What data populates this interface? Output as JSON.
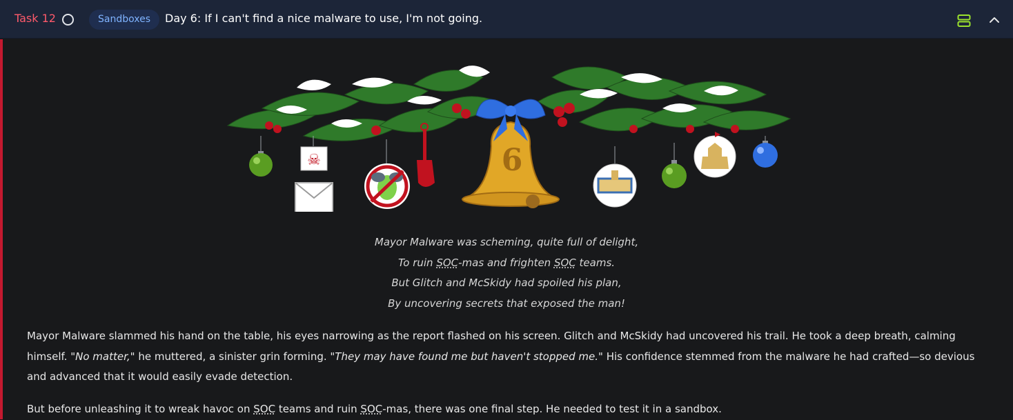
{
  "header": {
    "task_label": "Task 12",
    "tag": "Sandboxes",
    "title": "Day 6: If I can't find a nice malware to use, I'm not going."
  },
  "poem": {
    "line1": "Mayor Malware was scheming, quite full of delight,",
    "line2_pre": "To ruin ",
    "line2_abbr1": "SOC",
    "line2_mid": "-mas and frighten ",
    "line2_abbr2": "SOC",
    "line2_post": " teams.",
    "line3": "But Glitch and McSkidy had spoiled his plan,",
    "line4": "By uncovering secrets that exposed the man!"
  },
  "paragraph1": {
    "part1": "Mayor Malware slammed his hand on the table, his eyes narrowing as the report flashed on his screen. Glitch and McSkidy had uncovered his trail. He took a deep breath, calming himself. ",
    "quote1": "\"No matter,\"",
    "part2": " he muttered, a sinister grin forming. ",
    "quote2": "\"They may have found me but haven't stopped me.\"",
    "part3": " His confidence stemmed from the malware he had crafted—so devious and advanced that it would easily evade detection."
  },
  "paragraph2": {
    "part1": "But before unleashing it to wreak havoc on ",
    "abbr1": "SOC",
    "part2": " teams and ruin ",
    "abbr2": "SOC",
    "part3": "-mas, there was one final step. He needed to test it in a sandbox."
  },
  "banner": {
    "bell_number": "6"
  },
  "colors": {
    "header_bg": "#1c2538",
    "task_label": "#ff5a6b",
    "tag_bg": "#1f2e4f",
    "tag_text": "#7fb3ff",
    "accent_bar": "#c3192f",
    "layout_icon": "#9be22d",
    "page_bg": "#18191b"
  }
}
